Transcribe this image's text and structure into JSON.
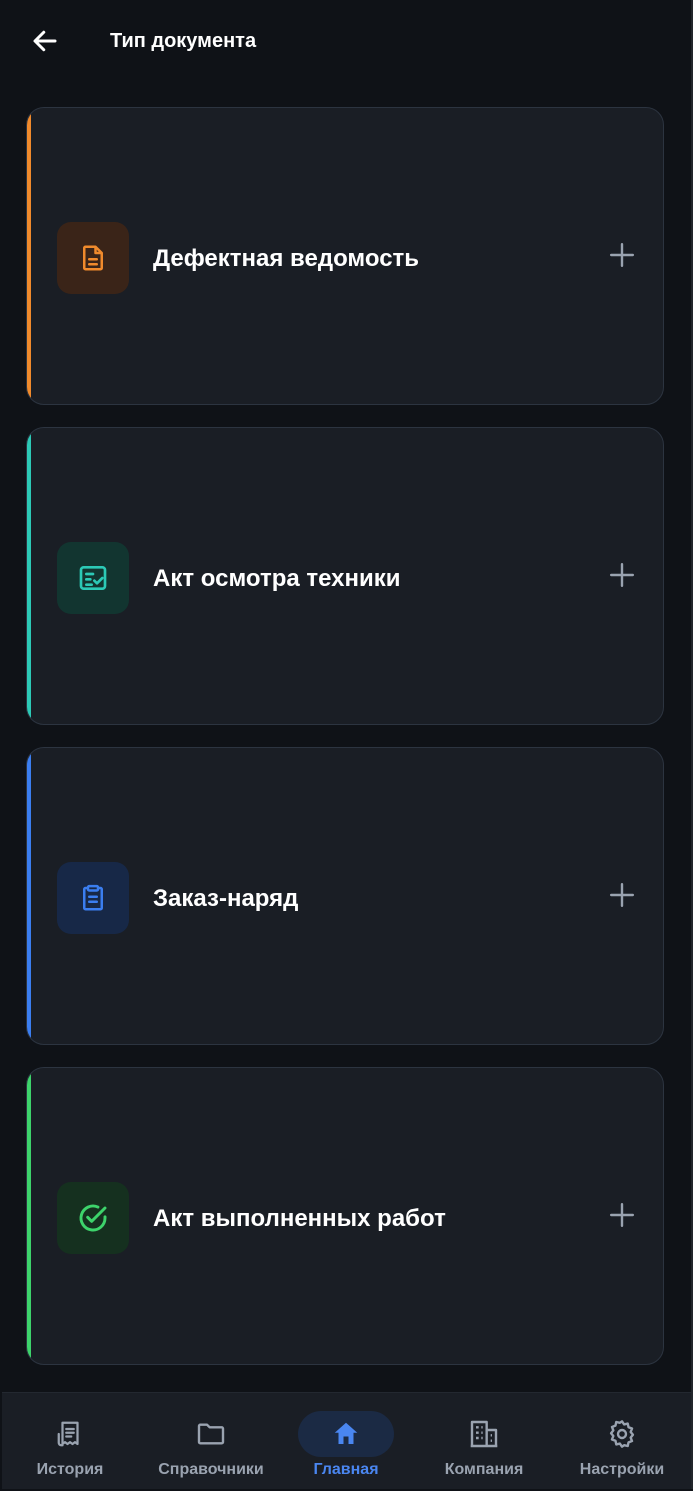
{
  "header": {
    "title": "Тип документа"
  },
  "cards": [
    {
      "label": "Дефектная ведомость",
      "accent": "#f08a2c",
      "icon_bg": "#3a2418",
      "icon_color": "#f08a2c",
      "icon": "document-icon"
    },
    {
      "label": "Акт осмотра техники",
      "accent": "#2cc9b6",
      "icon_bg": "#123530",
      "icon_color": "#2cc9b6",
      "icon": "checklist-icon"
    },
    {
      "label": "Заказ-наряд",
      "accent": "#3b7ef0",
      "icon_bg": "#172847",
      "icon_color": "#3b7ef0",
      "icon": "clipboard-icon"
    },
    {
      "label": "Акт выполненных работ",
      "accent": "#3dd36b",
      "icon_bg": "#15301f",
      "icon_color": "#3dd36b",
      "icon": "check-circle-icon"
    }
  ],
  "nav": {
    "items": [
      {
        "label": "История",
        "icon": "receipt-icon"
      },
      {
        "label": "Справочники",
        "icon": "folder-icon"
      },
      {
        "label": "Главная",
        "icon": "home-icon",
        "active": true
      },
      {
        "label": "Компания",
        "icon": "building-icon"
      },
      {
        "label": "Настройки",
        "icon": "gear-icon"
      }
    ]
  }
}
